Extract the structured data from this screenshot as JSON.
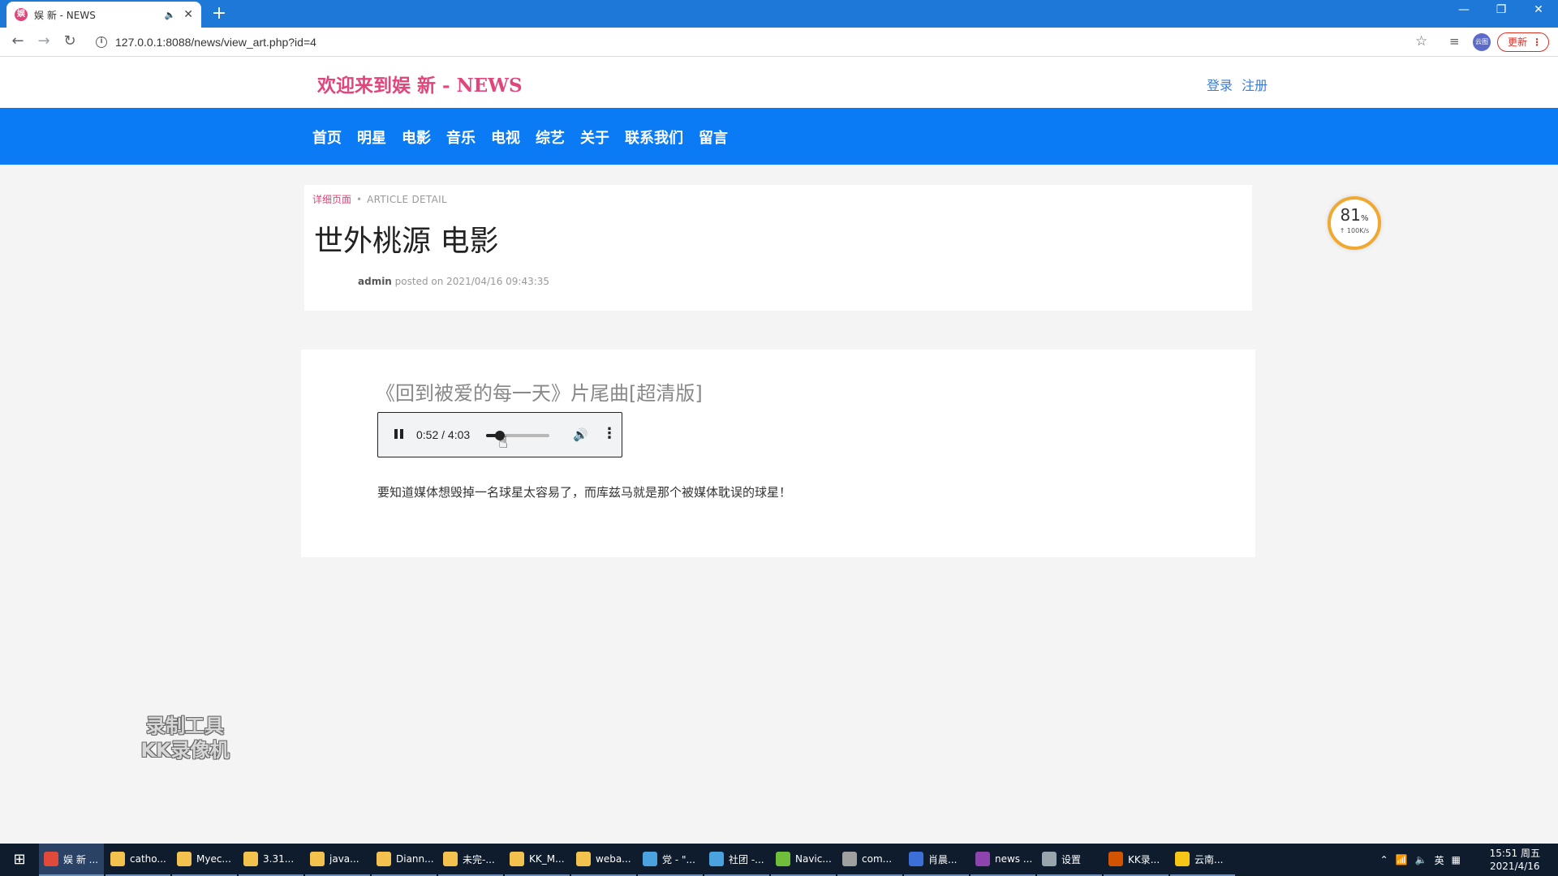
{
  "browser": {
    "tab_favicon_text": "娱",
    "tab_title": "娱 新 - NEWS",
    "tab_audio_icon": "speaker-icon",
    "new_tab_label": "+",
    "url": "127.0.0.1:8088/news/view_art.php?id=4",
    "profile_label": "云图",
    "update_label": "更新",
    "window_controls": [
      "—",
      "❐",
      "✕"
    ]
  },
  "site": {
    "title": "欢迎来到娱 新 - NEWS",
    "login": "登录",
    "register": "注册",
    "nav": [
      "首页",
      "明星",
      "电影",
      "音乐",
      "电视",
      "综艺",
      "关于",
      "联系我们",
      "留言"
    ]
  },
  "article": {
    "breadcrumb_page": "详细页面",
    "breadcrumb_separator": "•",
    "breadcrumb_detail": "ARTICLE  DETAIL",
    "title": "世外桃源 电影",
    "author": "admin",
    "posted_on": " posted on 2021/04/16 09:43:35",
    "media_title": "《回到被爱的每一天》片尾曲[超清版]",
    "audio": {
      "current_time": "0:52",
      "duration": "4:03",
      "time_display": "0:52 / 4:03",
      "progress_fraction": 0.214
    },
    "body": "要知道媒体想毁掉一名球星太容易了，而库兹马就是那个被媒体耽误的球星！"
  },
  "speed_widget": {
    "percent": "81",
    "percent_sign": "%",
    "rate": "↑ 100K/s"
  },
  "watermark": {
    "line1": "录制工具",
    "line2": "KK录像机"
  },
  "taskbar": {
    "items": [
      {
        "label": "娱 新 ...",
        "color": "#e04a3a",
        "active": true
      },
      {
        "label": "catho...",
        "color": "#f2c14e"
      },
      {
        "label": "Myec...",
        "color": "#f2c14e"
      },
      {
        "label": "3.31...",
        "color": "#f2c14e"
      },
      {
        "label": "java...",
        "color": "#f2c14e"
      },
      {
        "label": "Diann...",
        "color": "#f2c14e"
      },
      {
        "label": "未完-...",
        "color": "#f2c14e"
      },
      {
        "label": "KK_M...",
        "color": "#f2c14e"
      },
      {
        "label": "weba...",
        "color": "#f2c14e"
      },
      {
        "label": "党 - \"...",
        "color": "#4aa3df"
      },
      {
        "label": "社团 -...",
        "color": "#4aa3df"
      },
      {
        "label": "Navic...",
        "color": "#6fbf3a"
      },
      {
        "label": "com...",
        "color": "#a0a0a0"
      },
      {
        "label": "肖晨...",
        "color": "#3d6fd9"
      },
      {
        "label": "news ...",
        "color": "#8e44ad"
      },
      {
        "label": "设置",
        "color": "#9aa4ad"
      },
      {
        "label": "KK录...",
        "color": "#d35400"
      },
      {
        "label": "云南...",
        "color": "#f5c518"
      }
    ],
    "tray_lang": "英",
    "time": "15:51 周五",
    "date": "2021/4/16"
  }
}
